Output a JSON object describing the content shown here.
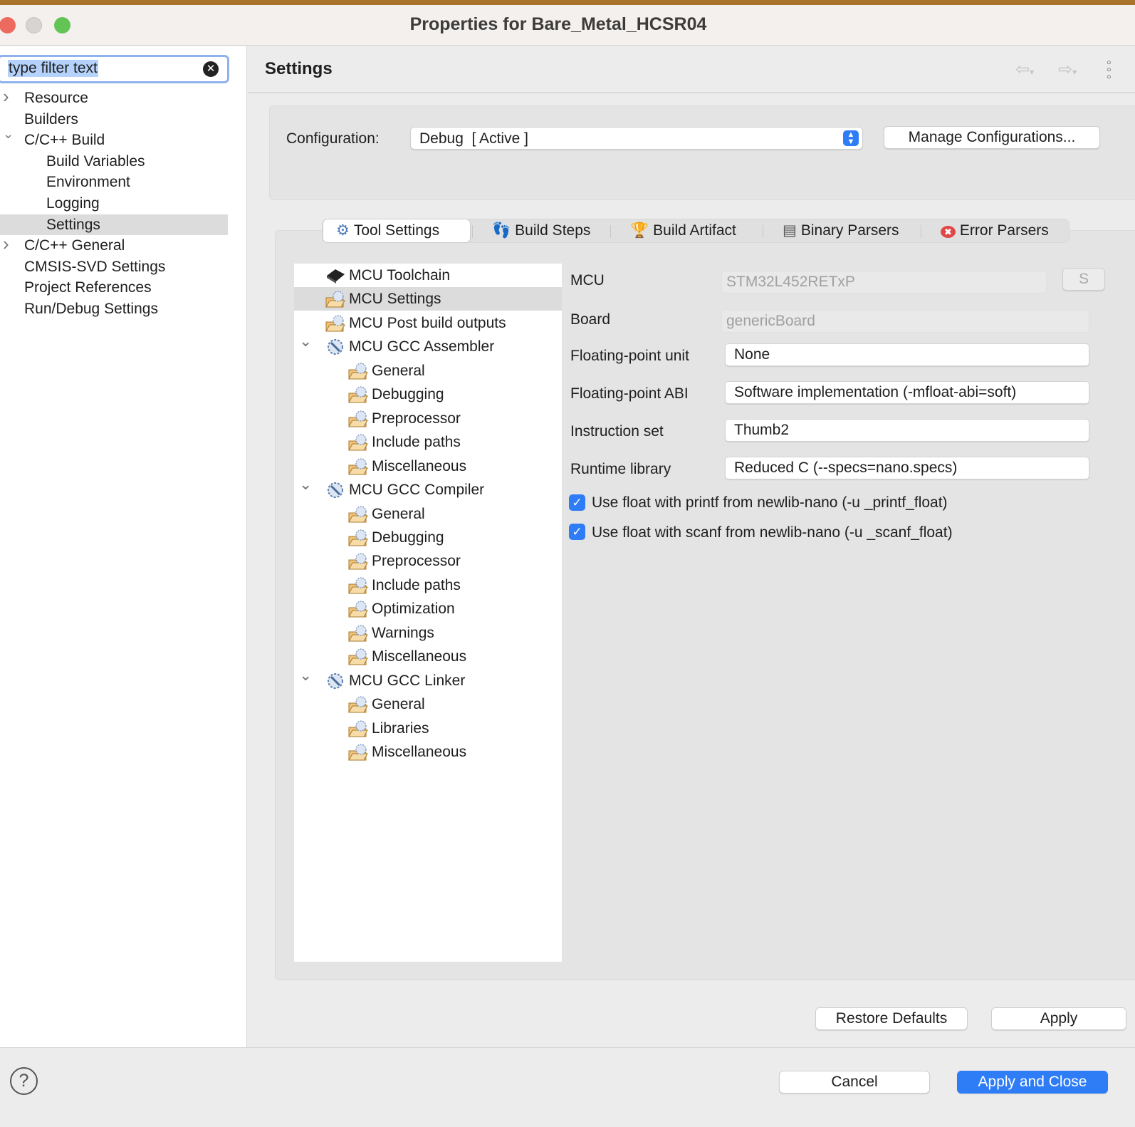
{
  "window": {
    "title": "Properties for Bare_Metal_HCSR04"
  },
  "filter": {
    "placeholder": "type filter text"
  },
  "left_tree": [
    {
      "label": "Resource",
      "level": 0,
      "chevron": "right"
    },
    {
      "label": "Builders",
      "level": 0,
      "chevron": ""
    },
    {
      "label": "C/C++ Build",
      "level": 0,
      "chevron": "down"
    },
    {
      "label": "Build Variables",
      "level": 1,
      "chevron": ""
    },
    {
      "label": "Environment",
      "level": 1,
      "chevron": ""
    },
    {
      "label": "Logging",
      "level": 1,
      "chevron": ""
    },
    {
      "label": "Settings",
      "level": 1,
      "chevron": "",
      "selected": true
    },
    {
      "label": "C/C++ General",
      "level": 0,
      "chevron": "right"
    },
    {
      "label": "CMSIS-SVD Settings",
      "level": 0,
      "chevron": ""
    },
    {
      "label": "Project References",
      "level": 0,
      "chevron": ""
    },
    {
      "label": "Run/Debug Settings",
      "level": 0,
      "chevron": ""
    }
  ],
  "header": {
    "title": "Settings"
  },
  "configuration": {
    "label": "Configuration:",
    "value": "Debug  [ Active ]",
    "manage_label": "Manage Configurations..."
  },
  "tabs": [
    {
      "label": "Tool Settings",
      "icon": "tool-settings-icon",
      "active": true
    },
    {
      "label": "Build Steps",
      "icon": "build-steps-icon"
    },
    {
      "label": "Build Artifact",
      "icon": "build-artifact-icon"
    },
    {
      "label": "Binary Parsers",
      "icon": "binary-parsers-icon"
    },
    {
      "label": "Error Parsers",
      "icon": "error-parsers-icon"
    }
  ],
  "tool_tree": [
    {
      "label": "MCU Toolchain",
      "level": 0,
      "icon": "chip-icon"
    },
    {
      "label": "MCU Settings",
      "level": 0,
      "icon": "folder-settings-icon",
      "selected": true
    },
    {
      "label": "MCU Post build outputs",
      "level": 0,
      "icon": "folder-settings-icon"
    },
    {
      "label": "MCU GCC Assembler",
      "level": 0,
      "icon": "tool-icon",
      "chevron": "down"
    },
    {
      "label": "General",
      "level": 1,
      "icon": "folder-settings-icon"
    },
    {
      "label": "Debugging",
      "level": 1,
      "icon": "folder-settings-icon"
    },
    {
      "label": "Preprocessor",
      "level": 1,
      "icon": "folder-settings-icon"
    },
    {
      "label": "Include paths",
      "level": 1,
      "icon": "folder-settings-icon"
    },
    {
      "label": "Miscellaneous",
      "level": 1,
      "icon": "folder-settings-icon"
    },
    {
      "label": "MCU GCC Compiler",
      "level": 0,
      "icon": "tool-icon",
      "chevron": "down"
    },
    {
      "label": "General",
      "level": 1,
      "icon": "folder-settings-icon"
    },
    {
      "label": "Debugging",
      "level": 1,
      "icon": "folder-settings-icon"
    },
    {
      "label": "Preprocessor",
      "level": 1,
      "icon": "folder-settings-icon"
    },
    {
      "label": "Include paths",
      "level": 1,
      "icon": "folder-settings-icon"
    },
    {
      "label": "Optimization",
      "level": 1,
      "icon": "folder-settings-icon"
    },
    {
      "label": "Warnings",
      "level": 1,
      "icon": "folder-settings-icon"
    },
    {
      "label": "Miscellaneous",
      "level": 1,
      "icon": "folder-settings-icon"
    },
    {
      "label": "MCU GCC Linker",
      "level": 0,
      "icon": "tool-icon",
      "chevron": "down"
    },
    {
      "label": "General",
      "level": 1,
      "icon": "folder-settings-icon"
    },
    {
      "label": "Libraries",
      "level": 1,
      "icon": "folder-settings-icon"
    },
    {
      "label": "Miscellaneous",
      "level": 1,
      "icon": "folder-settings-icon"
    }
  ],
  "form": {
    "mcu": {
      "label": "MCU",
      "value": "STM32L452RETxP",
      "select_button": "S"
    },
    "board": {
      "label": "Board",
      "value": "genericBoard"
    },
    "fpu": {
      "label": "Floating-point unit",
      "value": "None"
    },
    "abi": {
      "label": "Floating-point ABI",
      "value": "Software implementation (-mfloat-abi=soft)"
    },
    "iset": {
      "label": "Instruction set",
      "value": "Thumb2"
    },
    "runtime": {
      "label": "Runtime library",
      "value": "Reduced C (--specs=nano.specs)"
    },
    "printf_float": {
      "label": "Use float with printf from newlib-nano (-u _printf_float)",
      "checked": true
    },
    "scanf_float": {
      "label": "Use float with scanf from newlib-nano (-u _scanf_float)",
      "checked": true
    }
  },
  "buttons": {
    "restore": "Restore Defaults",
    "apply": "Apply",
    "cancel": "Cancel",
    "apply_close": "Apply and Close",
    "help": "?"
  },
  "colors": {
    "accent": "#2e7cf6"
  }
}
